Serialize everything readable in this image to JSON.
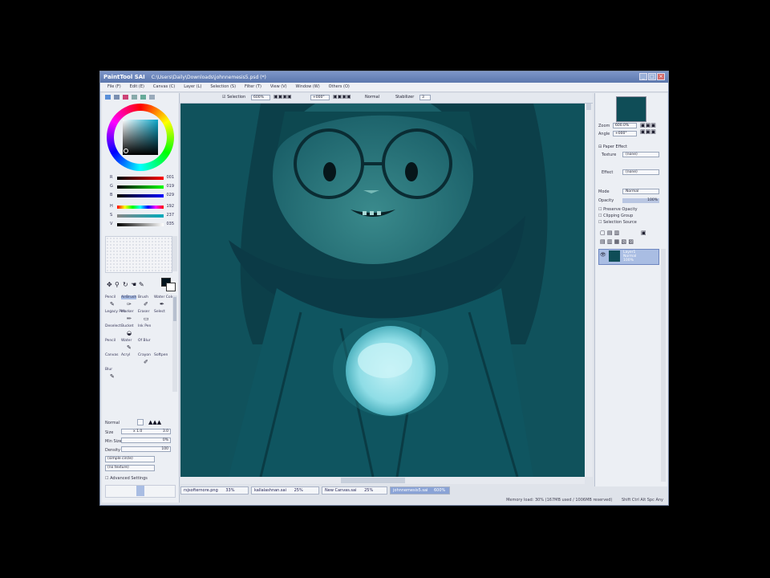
{
  "titlebar": {
    "app": "PaintTool SAI",
    "path": "C:\\Users\\Daily\\Downloads\\johnnemesis5.psd (*)",
    "controls": [
      "_",
      "□",
      "×"
    ]
  },
  "menu": [
    "File (F)",
    "Edit (E)",
    "Canvas (C)",
    "Layer (L)",
    "Selection (S)",
    "Filter (T)",
    "View (V)",
    "Window (W)",
    "Others (O)"
  ],
  "canvas_toolbar": {
    "selection_label": "Selection",
    "zoom": "600%",
    "angle": "+000°",
    "mode": "Normal",
    "stabilizer": "Stabilizer",
    "stabilizer_val": "3"
  },
  "color_sliders": [
    {
      "label": "R",
      "value": "001"
    },
    {
      "label": "G",
      "value": "019"
    },
    {
      "label": "B",
      "value": "029"
    },
    {
      "label": "H",
      "value": "192"
    },
    {
      "label": "S",
      "value": "237"
    },
    {
      "label": "V",
      "value": "035"
    }
  ],
  "tools": [
    [
      "Pencil",
      "AirBrush",
      "Brush",
      "Water Color"
    ],
    [
      "Legacy Pen",
      "Marker",
      "Eraser",
      "Select"
    ],
    [
      "Deselect",
      "Bucket",
      "Ink Pen",
      ""
    ],
    [
      "Pencil",
      "Water",
      "Of Blur",
      ""
    ],
    [
      "Canvas",
      "Acryl",
      "Crayon",
      "Softpen"
    ],
    [
      "Blur",
      "",
      "",
      ""
    ]
  ],
  "brush_settings": {
    "mode": "Normal",
    "size_label": "Size",
    "size_val": "x 1.0",
    "size_num": "3.0",
    "min_size_label": "Min Size",
    "min_size_val": "0%",
    "density_label": "Density",
    "density_val": "100",
    "shape": "(simple circle)",
    "texture": "(no texture)",
    "advanced": "Advanced Settings"
  },
  "navigator": {
    "zoom_label": "Zoom",
    "zoom_val": "600.0%",
    "angle_label": "Angle",
    "angle_val": "+000°"
  },
  "layer_panel": {
    "paper_effect": "Paper Effect",
    "texture_label": "Texture",
    "texture_val": "(none)",
    "effect_label": "Effect",
    "effect_val": "(none)",
    "mode_label": "Mode",
    "mode_val": "Normal",
    "opacity_label": "Opacity",
    "opacity_val": "100%",
    "preserve": "Preserve Opacity",
    "clipping": "Clipping Group",
    "selection_source": "Selection Source",
    "layer_name": "Layer1",
    "layer_mode": "Normal",
    "layer_opacity": "100%"
  },
  "tabs": [
    {
      "name": "rsjsofternore.png",
      "zoom": "33%"
    },
    {
      "name": "kallalashnan.sai",
      "zoom": "25%"
    },
    {
      "name": "New Canvas.sai",
      "zoom": "25%"
    },
    {
      "name": "johnnemesis5.sai",
      "zoom": "600%"
    }
  ],
  "status": "Memory load: 30% (167MB used / 1006MB reserved)",
  "status_icons": "Shift Ctrl Alt Spc Any",
  "colors": {
    "title": "#6a84bb",
    "canvas_bg": "#0f4d57",
    "accent": "#8aa3d6"
  }
}
